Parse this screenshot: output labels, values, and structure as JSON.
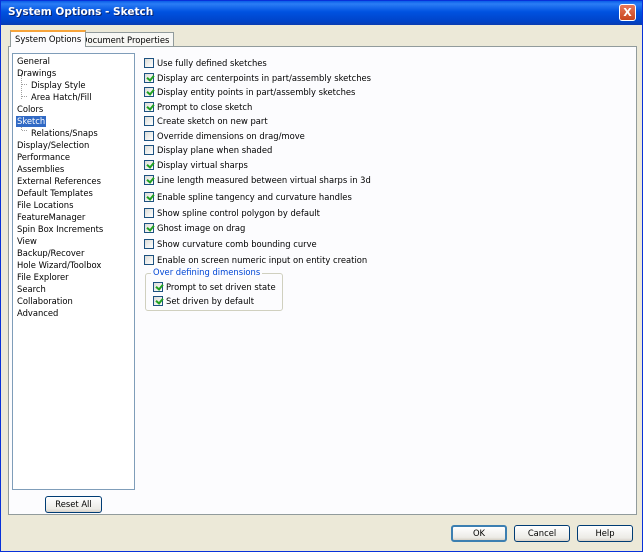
{
  "window": {
    "title": "System Options - Sketch",
    "close_label": "X"
  },
  "tabs": [
    {
      "label": "System Options",
      "active": true
    },
    {
      "label": "Document Properties",
      "active": false
    }
  ],
  "tree": {
    "items": [
      {
        "label": "General",
        "indent": 0
      },
      {
        "label": "Drawings",
        "indent": 0
      },
      {
        "label": "Display Style",
        "indent": 1
      },
      {
        "label": "Area Hatch/Fill",
        "indent": 1
      },
      {
        "label": "Colors",
        "indent": 0
      },
      {
        "label": "Sketch",
        "indent": 0,
        "selected": true
      },
      {
        "label": "Relations/Snaps",
        "indent": 1
      },
      {
        "label": "Display/Selection",
        "indent": 0
      },
      {
        "label": "Performance",
        "indent": 0
      },
      {
        "label": "Assemblies",
        "indent": 0
      },
      {
        "label": "External References",
        "indent": 0
      },
      {
        "label": "Default Templates",
        "indent": 0
      },
      {
        "label": "File Locations",
        "indent": 0
      },
      {
        "label": "FeatureManager",
        "indent": 0
      },
      {
        "label": "Spin Box Increments",
        "indent": 0
      },
      {
        "label": "View",
        "indent": 0
      },
      {
        "label": "Backup/Recover",
        "indent": 0
      },
      {
        "label": "Hole Wizard/Toolbox",
        "indent": 0
      },
      {
        "label": "File Explorer",
        "indent": 0
      },
      {
        "label": "Search",
        "indent": 0
      },
      {
        "label": "Collaboration",
        "indent": 0
      },
      {
        "label": "Advanced",
        "indent": 0
      }
    ]
  },
  "reset_label": "Reset All",
  "options": [
    {
      "label": "Use fully defined sketches",
      "checked": false
    },
    {
      "label": "Display arc centerpoints in part/assembly sketches",
      "checked": true
    },
    {
      "label": "Display entity points in part/assembly sketches",
      "checked": true
    },
    {
      "label": "Prompt to close sketch",
      "checked": true
    },
    {
      "label": "Create sketch on new part",
      "checked": false
    },
    {
      "label": "Override dimensions on drag/move",
      "checked": false
    },
    {
      "label": "Display plane when shaded",
      "checked": false
    },
    {
      "label": "Display virtual sharps",
      "checked": true
    },
    {
      "label": "Line length measured between virtual sharps in 3d",
      "checked": true
    },
    {
      "label": "Enable spline tangency and curvature handles",
      "checked": true
    },
    {
      "label": "Show spline control polygon by default",
      "checked": false
    },
    {
      "label": "Ghost image on drag",
      "checked": true
    },
    {
      "label": "Show curvature comb bounding curve",
      "checked": false
    },
    {
      "label": "Enable on screen numeric input on entity creation",
      "checked": false
    }
  ],
  "group": {
    "title": "Over defining dimensions",
    "options": [
      {
        "label": "Prompt to set driven state",
        "checked": true
      },
      {
        "label": "Set driven by default",
        "checked": true
      }
    ]
  },
  "buttons": {
    "ok": "OK",
    "cancel": "Cancel",
    "help": "Help"
  }
}
